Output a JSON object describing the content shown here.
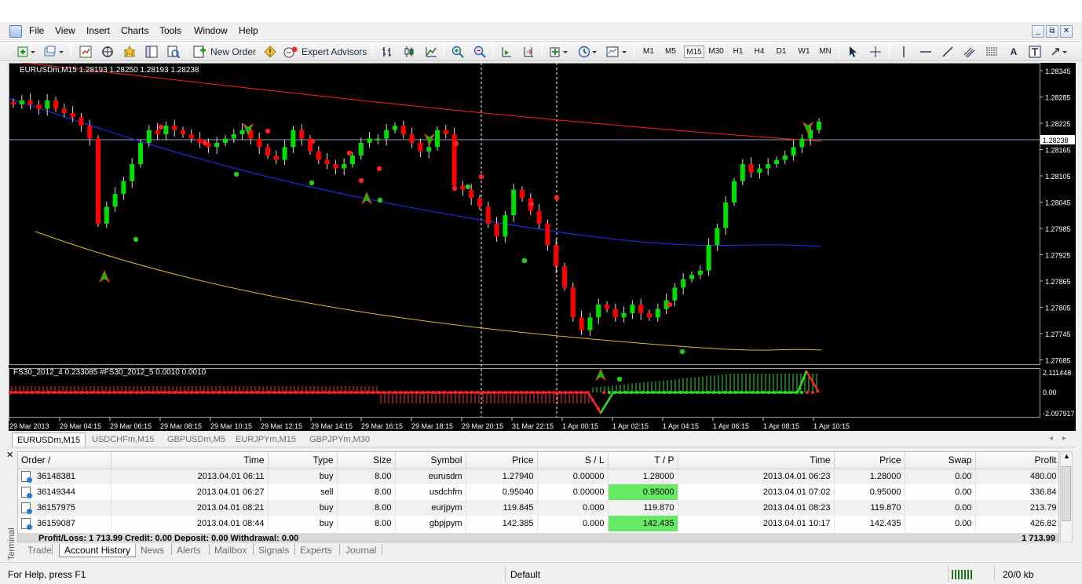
{
  "menu": [
    "File",
    "View",
    "Insert",
    "Charts",
    "Tools",
    "Window",
    "Help"
  ],
  "toolbar": {
    "new_order": "New Order",
    "expert_advisors": "Expert Advisors",
    "timeframes": [
      "M1",
      "M5",
      "M15",
      "M30",
      "H1",
      "H4",
      "D1",
      "W1",
      "MN"
    ],
    "active_timeframe": "M15"
  },
  "chart": {
    "header": "EURUSDm,M15  1.28193 1.28250 1.28193 1.28238",
    "current_price": "1.28238",
    "price_labels": [
      "1.28345",
      "1.28285",
      "1.28225",
      "1.28165",
      "1.28105",
      "1.28045",
      "1.27985",
      "1.27925",
      "1.27865",
      "1.27805",
      "1.27745",
      "1.27685"
    ],
    "time_labels": [
      "29 Mar 2013",
      "29 Mar 04:15",
      "29 Mar 06:15",
      "29 Mar 08:15",
      "29 Mar 10:15",
      "29 Mar 12:15",
      "29 Mar 14:15",
      "29 Mar 16:15",
      "29 Mar 18:15",
      "29 Mar 20:15",
      "31 Mar 22:15",
      "1 Apr 00:15",
      "1 Apr 02:15",
      "1 Apr 04:15",
      "1 Apr 06:15",
      "1 Apr 08:15",
      "1 Apr 10:15"
    ],
    "indicator_header": "FS30_2012_4 0.233085  #FS30_2012_5 0.0010 0.0010",
    "indicator_labels": [
      "2.111448",
      "0.00",
      "-2.097917"
    ]
  },
  "chart_data": {
    "type": "line",
    "title": "EURUSDm,M15",
    "series": [
      {
        "name": "EURUSDm",
        "values": [
          1.2828,
          1.2829,
          1.2828,
          1.2827,
          1.2829,
          1.2827,
          1.2826,
          1.2825,
          1.2823,
          1.282,
          1.28,
          1.2804,
          1.2807,
          1.281,
          1.2814,
          1.2819,
          1.2822,
          1.2821,
          1.2823,
          1.2822,
          1.2821,
          1.282,
          1.2819,
          1.2818,
          1.2819,
          1.282,
          1.2821,
          1.2822,
          1.282,
          1.2818,
          1.2816,
          1.2815,
          1.2818,
          1.2822,
          1.282,
          1.2817,
          1.2815,
          1.2814,
          1.2813,
          1.2814,
          1.2816,
          1.2819,
          1.282,
          1.282,
          1.2822,
          1.2823,
          1.2821,
          1.2819,
          1.2817,
          1.2818,
          1.2822,
          1.2821,
          1.2809,
          1.2808,
          1.2806,
          1.2804,
          1.28,
          1.2797,
          1.2802,
          1.2808,
          1.2806,
          1.2803,
          1.28,
          1.2795,
          1.279,
          1.2785,
          1.2778,
          1.2775,
          1.2778,
          1.2781,
          1.278,
          1.2778,
          1.2779,
          1.2781,
          1.2779,
          1.2778,
          1.278,
          1.2782,
          1.2785,
          1.2787,
          1.2788,
          1.2789,
          1.2795,
          1.2799,
          1.2805,
          1.281,
          1.2814,
          1.2812,
          1.2813,
          1.2814,
          1.2815,
          1.2816,
          1.2818,
          1.282,
          1.2822,
          1.2824
        ]
      }
    ],
    "ylim": [
      1.27685,
      1.28345
    ]
  },
  "symbol_tabs": [
    "EURUSDm,M15",
    "USDCHFm,M15",
    "GBPUSDm,M5",
    "EURJPYm,M15",
    "GBPJPYm,M30"
  ],
  "history": {
    "columns": [
      "Order  /",
      "Time",
      "Type",
      "Size",
      "Symbol",
      "Price",
      "S / L",
      "T / P",
      "Time",
      "Price",
      "Swap",
      "Profit"
    ],
    "rows": [
      [
        "36148381",
        "2013.04.01 06:11",
        "buy",
        "8.00",
        "eurusdm",
        "1.27940",
        "0.00000",
        "1.28000",
        "2013.04.01 06:23",
        "1.28000",
        "0.00",
        "480.00"
      ],
      [
        "36149344",
        "2013.04.01 06:27",
        "sell",
        "8.00",
        "usdchfm",
        "0.95040",
        "0.00000",
        "0.95000",
        "2013.04.01 07:02",
        "0.95000",
        "0.00",
        "336.84"
      ],
      [
        "36157975",
        "2013.04.01 08:21",
        "buy",
        "8.00",
        "eurjpym",
        "119.845",
        "0.000",
        "119.870",
        "2013.04.01 08:23",
        "119.870",
        "0.00",
        "213.79"
      ],
      [
        "36159087",
        "2013.04.01 08:44",
        "buy",
        "8.00",
        "gbpjpym",
        "142.385",
        "0.000",
        "142.435",
        "2013.04.01 10:17",
        "142.435",
        "0.00",
        "426.82"
      ]
    ],
    "summary": "Profit/Loss: 1 713.99  Credit: 0.00  Deposit: 0.00  Withdrawal: 0.00",
    "summary_total": "1 713.99"
  },
  "terminal_tabs": [
    "Trade",
    "Account History",
    "News",
    "Alerts",
    "Mailbox",
    "Signals",
    "Experts",
    "Journal"
  ],
  "terminal_label": "Terminal",
  "status": {
    "help": "For Help, press F1",
    "profile": "Default",
    "traffic": "20/0 kb"
  },
  "colors": {
    "bull": "#00e000",
    "bear": "#ff0000",
    "ma_red": "#ff2020",
    "ma_blue": "#2030ff",
    "ma_gold": "#e0b830",
    "tp_cell": "#67ea63"
  }
}
